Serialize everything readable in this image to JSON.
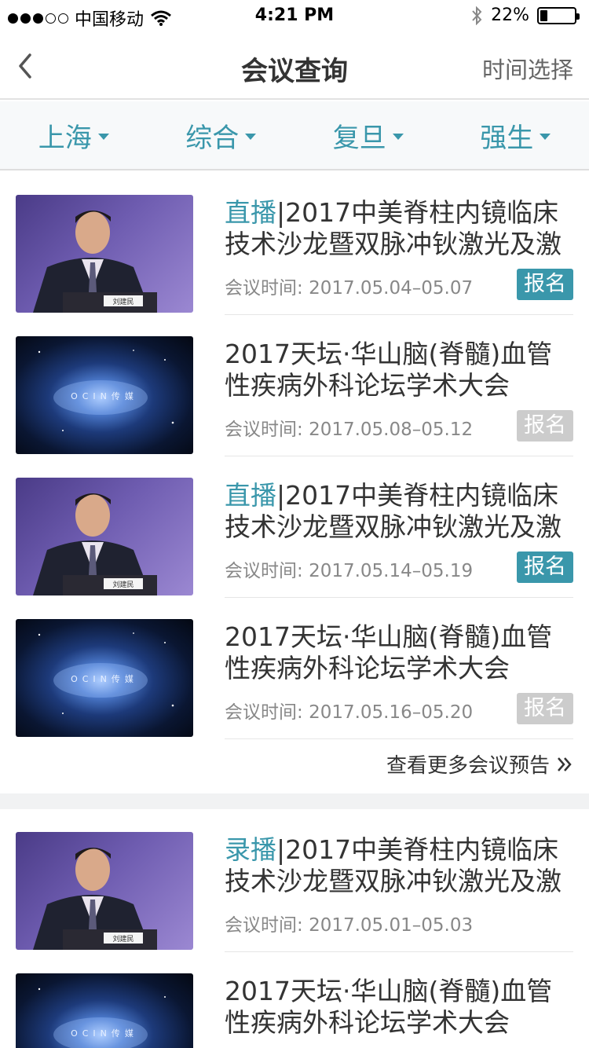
{
  "status_bar": {
    "carrier": "中国移动",
    "time": "4:21 PM",
    "battery": "22%",
    "battery_level": 0.22,
    "signal_bars_filled": 3,
    "signal_bars_total": 5
  },
  "nav": {
    "title": "会议查询",
    "right_label": "时间选择"
  },
  "filters": [
    {
      "label": "上海"
    },
    {
      "label": "综合"
    },
    {
      "label": "复旦"
    },
    {
      "label": "强生"
    }
  ],
  "colors": {
    "accent": "#3a97ab",
    "disabled": "#cccccc"
  },
  "section1": {
    "items": [
      {
        "tag": "直播",
        "title": "|2017中美脊柱内镜临床技术沙龙暨双脉冲钬激光及激",
        "time_label": "会议时间:",
        "time": "2017.05.04–05.07",
        "button": "报名",
        "thumb": "speaker"
      },
      {
        "tag": "",
        "title": "2017天坛·华山脑(脊髓)血管性疾病外科论坛学术大会",
        "time_label": "会议时间:",
        "time": "2017.05.08–05.12",
        "button": "报名",
        "thumb": "space"
      },
      {
        "tag": "直播",
        "title": "|2017中美脊柱内镜临床技术沙龙暨双脉冲钬激光及激",
        "time_label": "会议时间:",
        "time": "2017.05.14–05.19",
        "button": "报名",
        "thumb": "speaker"
      },
      {
        "tag": "",
        "title": "2017天坛·华山脑(脊髓)血管性疾病外科论坛学术大会",
        "time_label": "会议时间:",
        "time": "2017.05.16–05.20",
        "button": "报名",
        "thumb": "space"
      }
    ],
    "more_label": "查看更多会议预告"
  },
  "section2": {
    "items": [
      {
        "tag": "录播",
        "title": "|2017中美脊柱内镜临床技术沙龙暨双脉冲钬激光及激",
        "time_label": "会议时间:",
        "time": "2017.05.01–05.03",
        "thumb": "speaker"
      },
      {
        "tag": "",
        "title": "2017天坛·华山脑(脊髓)血管性疾病外科论坛学术大会",
        "thumb": "space"
      }
    ]
  },
  "thumb_texts": {
    "speaker_nameplate": "刘建民",
    "space_watermark": "OCIN传媒"
  }
}
